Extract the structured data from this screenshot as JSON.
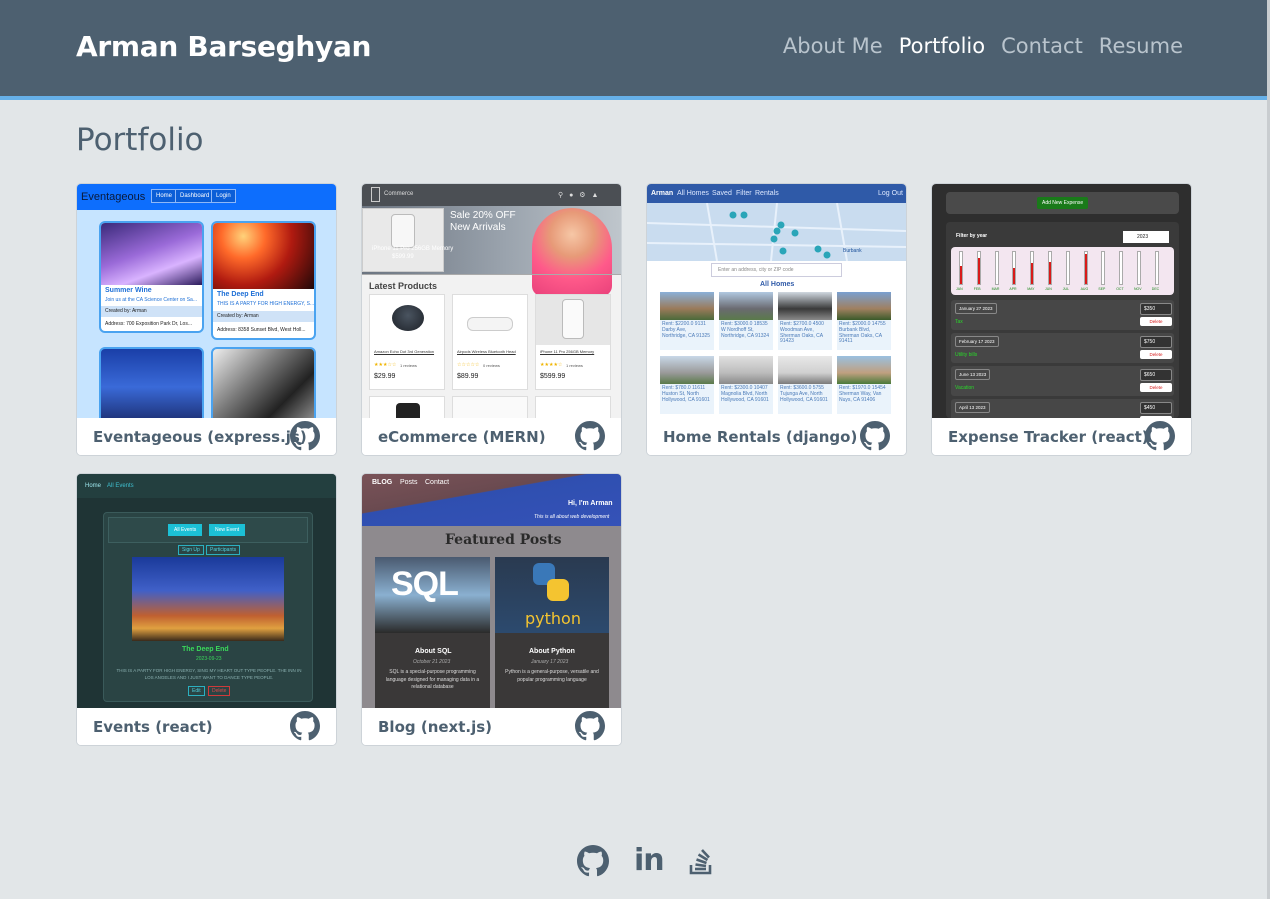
{
  "header": {
    "brand": "Arman Barseghyan",
    "nav": [
      "About Me",
      "Portfolio",
      "Contact",
      "Resume"
    ],
    "active_nav": "Portfolio",
    "background": "#4d6070",
    "accent": "#66b0e8"
  },
  "page": {
    "title": "Portfolio"
  },
  "projects": [
    {
      "title": "Eventageous (express.js)",
      "icon": "github-icon",
      "preview": {
        "logo": "Eventageous",
        "nav": [
          "Home",
          "Dashboard",
          "Login"
        ],
        "events": [
          {
            "name": "Summer Wine",
            "desc": "Join us at the CA Science Center on Sa...",
            "created_by": "Created by: Arman",
            "address": "Address: 700 Exposition Park Dr, Los..."
          },
          {
            "name": "The Deep End",
            "desc": "THIS IS A PARTY FOR HIGH ENERGY, S...",
            "created_by": "Created by: Arman",
            "address": "Address: 8358 Sunset Blvd, West Holl..."
          }
        ]
      }
    },
    {
      "title": "eCommerce (MERN)",
      "icon": "github-icon",
      "preview": {
        "logo_text": "Commerce",
        "banner_headline": "Sale 20% OFF",
        "banner_sub": "New Arrivals",
        "banner_product": "iPhone 11 Pro 256GB Memory",
        "banner_price": "$599.99",
        "section": "Latest Products",
        "products": [
          {
            "name": "Amazon Echo Dot 3rd Generation",
            "reviews": "1 reviews",
            "price": "$29.99"
          },
          {
            "name": "Airpods Wireless Bluetooth Head",
            "reviews": "0 reviews",
            "price": "$89.99"
          },
          {
            "name": "iPhone 11 Pro 256GB Memory",
            "reviews": "1 reviews",
            "price": "$599.99"
          }
        ]
      }
    },
    {
      "title": "Home Rentals (django)",
      "icon": "github-icon",
      "preview": {
        "nav": [
          "Arman",
          "All Homes",
          "Saved",
          "Filter",
          "Rentals"
        ],
        "logout": "Log Out",
        "search_placeholder": "Enter an address, city or ZIP code",
        "section": "All Homes",
        "map_label": "Burbank",
        "listings": [
          {
            "text": "Rent: $2200.0 9131 Darby Ave, Northridge, CA 91325"
          },
          {
            "text": "Rent: $3000.0 18535 W Nordhoff St, Northridge, CA 91324"
          },
          {
            "text": "Rent: $2700.0 4500 Woodman Ave, Sherman Oaks, CA 91423"
          },
          {
            "text": "Rent: $2000.0 14755 Burbank Blvd, Sherman Oaks, CA 91411"
          },
          {
            "text": "Rent: $780.0 11611 Huston St, North Hollywood, CA 91601"
          },
          {
            "text": "Rent: $2300.0 10407 Magnolia Blvd, North Hollywood, CA 91601"
          },
          {
            "text": "Rent: $3600.0 5755 Tujunga Ave, North Hollywood, CA 91601"
          },
          {
            "text": "Rent: $1970.0 15454 Sherman Way, Van Nuys, CA 91406"
          }
        ]
      }
    },
    {
      "title": "Expense Tracker (react)",
      "icon": "github-icon",
      "preview": {
        "add_button": "Add New Expense",
        "filter_label": "Filter by year",
        "year": "2023",
        "months": [
          "JAN",
          "FEB",
          "MAR",
          "APR",
          "MAY",
          "JUN",
          "JUL",
          "AUG",
          "SEP",
          "OCT",
          "NOV",
          "DEC"
        ],
        "month_fill": [
          0.55,
          0.8,
          0,
          0.5,
          0.65,
          0.7,
          0,
          0.95,
          0,
          0,
          0,
          0
        ],
        "expenses": [
          {
            "date": "January 27 2023",
            "title": "Tax",
            "amount": "$350",
            "action": "Delete"
          },
          {
            "date": "February 17 2023",
            "title": "Utility bills",
            "amount": "$750",
            "action": "Delete"
          },
          {
            "date": "June 13 2023",
            "title": "Vacation",
            "amount": "$650",
            "action": "Delete"
          },
          {
            "date": "April 13 2023",
            "title": "Rent",
            "amount": "$450",
            "action": "Delete"
          }
        ]
      }
    },
    {
      "title": "Events (react)",
      "icon": "github-icon",
      "preview": {
        "nav": [
          "Home",
          "All Events"
        ],
        "buttons": [
          "All Events",
          "New Event"
        ],
        "sub_buttons": [
          "Sign Up",
          "Participants"
        ],
        "event_name": "The Deep End",
        "event_date": "2023-09-23",
        "event_desc": "THIS IS A PARTY FOR HIGH ENERGY, SING MY HEART OUT TYPE PEOPLE. THE INN IN LOS ANGELES AND I JUST WANT TO DANCE TYPE PEOPLE.",
        "actions": [
          "Edit",
          "Delete"
        ]
      }
    },
    {
      "title": "Blog (next.js)",
      "icon": "github-icon",
      "preview": {
        "nav": [
          "BLOG",
          "Posts",
          "Contact"
        ],
        "hero_title": "Hi, I'm Arman",
        "hero_sub": "This is all about web development",
        "section": "Featured Posts",
        "posts": [
          {
            "image_text": "SQL",
            "title": "About SQL",
            "date": "October 21 2023",
            "desc": "SQL is a special-purpose programming language designed for managing data in a relational database"
          },
          {
            "image_text": "python",
            "title": "About Python",
            "date": "January 17 2023",
            "desc": "Python is a general-purpose, versatile and popular programming language"
          }
        ]
      }
    }
  ],
  "footer": {
    "icons": [
      "github-icon",
      "linkedin-icon",
      "stackoverflow-icon"
    ],
    "linkedin_text": "in"
  }
}
